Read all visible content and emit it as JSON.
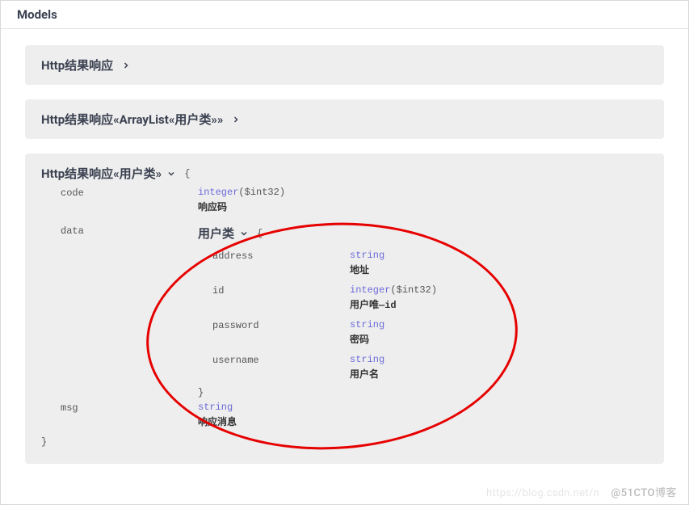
{
  "header": {
    "title": "Models"
  },
  "models": {
    "collapsed1": {
      "title": "Http结果响应"
    },
    "collapsed2": {
      "title": "Http结果响应«ArrayList«用户类»»"
    },
    "expanded": {
      "title": "Http结果响应«用户类»",
      "open_brace": "{",
      "props": {
        "code": {
          "name": "code",
          "type": "integer",
          "format": "($int32)",
          "desc": "响应码"
        },
        "data": {
          "name": "data",
          "nested_title": "用户类",
          "open_brace": "{",
          "fields": {
            "address": {
              "name": "address",
              "type": "string",
              "desc": "地址"
            },
            "id": {
              "name": "id",
              "type": "integer",
              "format": "($int32)",
              "desc": "用户唯—id"
            },
            "password": {
              "name": "password",
              "type": "string",
              "desc": "密码"
            },
            "username": {
              "name": "username",
              "type": "string",
              "desc": "用户名"
            }
          },
          "close_brace": "}"
        },
        "msg": {
          "name": "msg",
          "type": "string",
          "desc": "响应消息"
        }
      },
      "close_brace": "}"
    }
  },
  "watermark": {
    "center": "https://blog.csdn.net/n",
    "right": "@51CTO博客"
  }
}
